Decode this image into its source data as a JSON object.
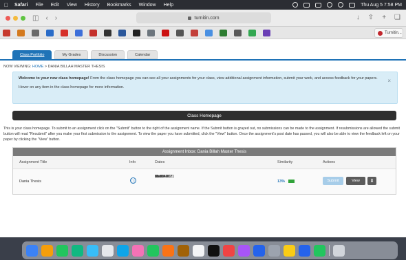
{
  "menubar": {
    "app": "Safari",
    "items": [
      "File",
      "Edit",
      "View",
      "History",
      "Bookmarks",
      "Window",
      "Help"
    ],
    "clock": "Thu Aug 5  7:58 PM"
  },
  "toolbar": {
    "url": "turnitin.com"
  },
  "favorites": {
    "icons": [
      "#c73a2e",
      "#d47a1f",
      "#6a6a6a",
      "#2a6cc8",
      "#d6302a",
      "#3d6fd9",
      "#c4302b",
      "#333333",
      "#2b579a",
      "#222222",
      "#6c757d",
      "#cc1111",
      "#555555",
      "#c3403a",
      "#4a90e2",
      "#2e7d32",
      "#5a5a5a",
      "#33a852",
      "#6a3fb5"
    ],
    "tab_label": "Turnitin..."
  },
  "nav": {
    "tabs": [
      "Class Portfolio",
      "My Grades",
      "Discussion",
      "Calendar"
    ]
  },
  "breadcrumb": {
    "prefix": "NOW VIEWING:",
    "home": "HOME",
    "sep": ">",
    "current": "DANIA BILLAH MASTER THESIS"
  },
  "welcome": {
    "bold": "Welcome to your new class homepage!",
    "text": " From the class homepage you can see all your assignments for your class, view additional assignment information, submit your work, and access feedback for your papers.",
    "hover": "Hover on any item in the class homepage for more information.",
    "close": "×"
  },
  "homepage": {
    "title": "Class Homepage",
    "description": "This is your class homepage. To submit to an assignment click on the \"Submit\" button to the right of the assignment name. If the Submit button is grayed out, no submissions can be made to the assignment. If resubmissions are allowed the submit button will read \"Resubmit\" after you make your first submission to the assignment. To view the paper you have submitted, click the \"View\" button. Once the assignment's post date has passed, you will also be able to view the feedback left on your paper by clicking the \"View\" button."
  },
  "inbox": {
    "title": "Assignment Inbox: Dania Billah Master Thesis",
    "columns": {
      "title": "Assignment Title",
      "info": "Info",
      "dates": "Dates",
      "similarity": "Similarity",
      "actions": "Actions"
    },
    "row": {
      "title": "Dania Thesis",
      "info_icon": "ⓘ",
      "dates": [
        {
          "label": "Start",
          "date": "11-Jun-2021",
          "time": "10:38AM"
        },
        {
          "label": "Due",
          "date": "30-Jun-2021",
          "time": "11:59PM"
        },
        {
          "label": "Post",
          "date": "30-Jun-2021",
          "time": "11:59PM"
        }
      ],
      "similarity": "13%",
      "similarity_color": "#31a33a",
      "submit": "Submit",
      "view": "View",
      "download_icon": "⬇"
    }
  },
  "dock": {
    "icons": [
      "#3b82f6",
      "#f59e0b",
      "#22c55e",
      "#10b981",
      "#38bdf8",
      "#e5e7eb",
      "#0ea5e9",
      "#f472b6",
      "#22c55e",
      "#f97316",
      "#a16207",
      "#f3f4f6",
      "#111111",
      "#ef4444",
      "#a855f7",
      "#2563eb",
      "#9ca3af",
      "#facc15",
      "#2563eb",
      "#22c55e",
      "#d1d5db"
    ]
  }
}
